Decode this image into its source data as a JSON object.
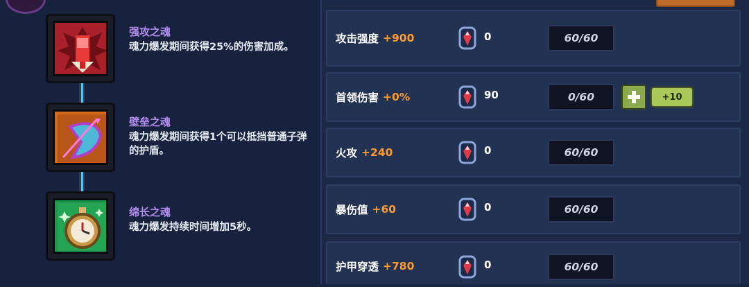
{
  "colors": {
    "background": "#182540",
    "row": "#213253",
    "bonus": "#ff9a2e",
    "soul_title": "#b48cf0",
    "connector": "#35d0ff",
    "plus_button": "#8aa84c"
  },
  "souls": [
    {
      "title": "强攻之魂",
      "description": "魂力爆发期间获得25%的伤害加成。",
      "icon": "red-soul-emblem-icon",
      "frame_color": "#a8202a"
    },
    {
      "title": "壁垒之魂",
      "description": "魂力爆发期间获得1个可以抵挡普通子弹的护盾。",
      "icon": "shield-bow-icon",
      "frame_color": "#d46a1a"
    },
    {
      "title": "绵长之魂",
      "description": "魂力爆发持续时间增加5秒。",
      "icon": "stopwatch-icon",
      "frame_color": "#1c9a4a"
    }
  ],
  "stats": [
    {
      "label": "攻击强度",
      "bonus": "+900",
      "gems": "0",
      "level": "60/60"
    },
    {
      "label": "首领伤害",
      "bonus": "+0%",
      "gems": "90",
      "level": "0/60",
      "upgrade_label": "+10"
    },
    {
      "label": "火攻",
      "bonus": "+240",
      "gems": "0",
      "level": "60/60"
    },
    {
      "label": "暴伤值",
      "bonus": "+60",
      "gems": "0",
      "level": "60/60"
    },
    {
      "label": "护甲穿透",
      "bonus": "+780",
      "gems": "0",
      "level": "60/60"
    }
  ]
}
